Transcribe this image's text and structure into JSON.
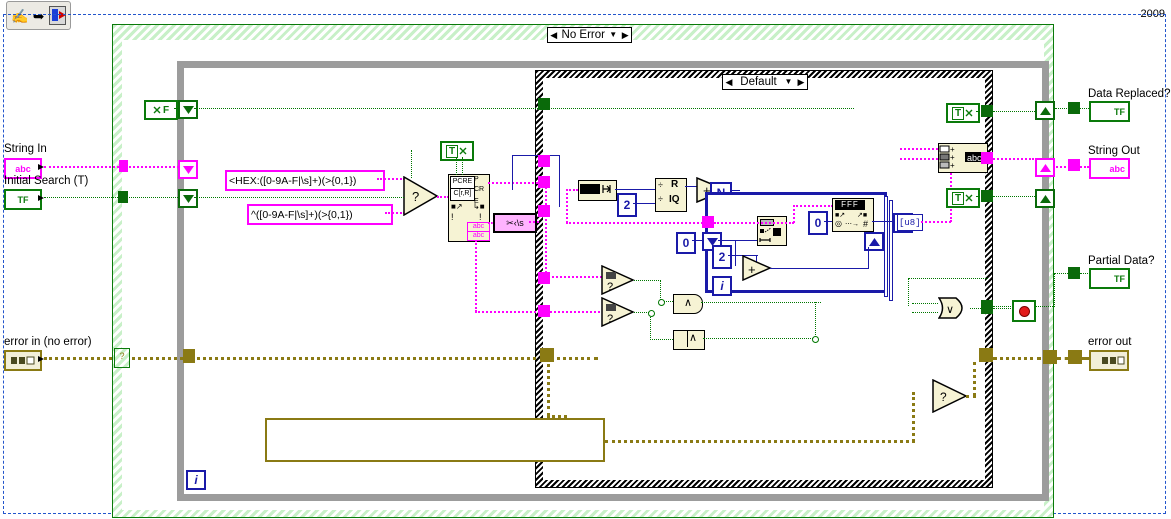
{
  "window": {
    "year_label": "2009",
    "toolbar": {
      "hand_tool": "hand-tool",
      "arrow_tool": "arrow-tool",
      "run_tool": "run-vi"
    }
  },
  "structures": {
    "error_case": {
      "label": "No Error",
      "left_arrow": "◀",
      "right_arrow": "▶",
      "dropdown": "▼"
    },
    "default_case": {
      "label": "Default",
      "left_arrow": "◀",
      "right_arrow": "▶",
      "dropdown": "▼"
    },
    "while_loop_index": "i",
    "for_loop_index": "i",
    "for_loop_count": "N"
  },
  "controls": [
    {
      "name": "string-in",
      "label": "String In",
      "terminal_text": "abc",
      "type": "string"
    },
    {
      "name": "initial-search",
      "label": "Initial Search (T)",
      "terminal_text": "TF",
      "type": "boolean"
    },
    {
      "name": "error-in",
      "label": "error in (no error)",
      "terminal_text": "",
      "type": "error-cluster"
    }
  ],
  "indicators": [
    {
      "name": "data-replaced",
      "label": "Data Replaced?",
      "terminal_text": "TF",
      "type": "boolean"
    },
    {
      "name": "string-out",
      "label": "String Out",
      "terminal_text": "abc",
      "type": "string"
    },
    {
      "name": "partial-data",
      "label": "Partial Data?",
      "terminal_text": "TF",
      "type": "boolean"
    },
    {
      "name": "error-out",
      "label": "error out",
      "terminal_text": "",
      "type": "error-cluster"
    }
  ],
  "constants": {
    "regex_hex_open": "<HEX:([0-9A-F|\\s]+)(>{0,1})",
    "regex_hex_caret": "^([0-9A-F|\\s]+)(>{0,1})",
    "two_a": "2",
    "two_b": "2",
    "zero_a": "0",
    "zero_b": "0",
    "true_const_a": "T",
    "true_const_b": "T",
    "false_const": "F",
    "empty_string": ""
  },
  "nodes": [
    {
      "name": "match-regular-expression",
      "top_label": "PCRE",
      "mid_label": "C[r,R]",
      "out_labels": [
        "P",
        "CR",
        "E"
      ]
    },
    {
      "name": "search-split-string",
      "label": "✂‹\\s"
    },
    {
      "name": "string-length",
      "label": "string-length"
    },
    {
      "name": "quotient-remainder",
      "label_top": "R",
      "label_bottom": "IQ"
    },
    {
      "name": "add-1",
      "label": "+"
    },
    {
      "name": "add-2",
      "label": "+"
    },
    {
      "name": "string-subset",
      "label": "string-subset"
    },
    {
      "name": "hex-string-to-number",
      "label": "FFF"
    },
    {
      "name": "byte-array-to-string",
      "label": "[]"
    },
    {
      "name": "concatenate-strings",
      "label": "concat"
    },
    {
      "name": "empty-string-compare-1",
      "label": "?"
    },
    {
      "name": "empty-string-compare-2",
      "label": "?"
    },
    {
      "name": "and-gate",
      "label": "∧"
    },
    {
      "name": "compound-and",
      "label": "∧"
    },
    {
      "name": "or-gate",
      "label": "∨"
    },
    {
      "name": "select-1",
      "label": "?"
    },
    {
      "name": "select-2",
      "label": "?"
    },
    {
      "name": "select-3",
      "label": "?"
    },
    {
      "name": "error-merge",
      "label": "?"
    },
    {
      "name": "stop-indicator",
      "label": "stop"
    }
  ]
}
